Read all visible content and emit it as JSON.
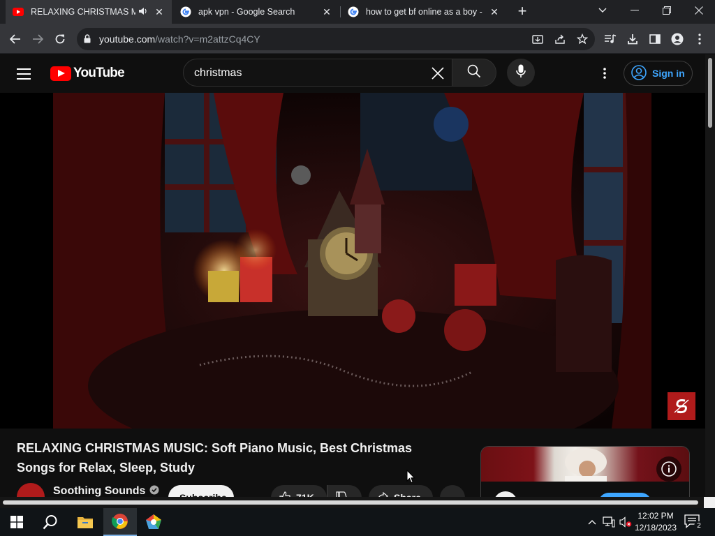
{
  "browser": {
    "tabs": [
      {
        "title": "RELAXING CHRISTMAS MUS",
        "favicon": "youtube-icon",
        "audio": true,
        "active": true
      },
      {
        "title": "apk vpn - Google Search",
        "favicon": "google-icon",
        "active": false
      },
      {
        "title": "how to get bf online as a boy - G",
        "favicon": "google-icon",
        "active": false
      }
    ],
    "url_domain": "youtube.com",
    "url_path": "/watch?v=m2attzCq4CY"
  },
  "youtube": {
    "logo_text": "YouTube",
    "search_query": "christmas",
    "signin_label": "Sign in"
  },
  "video": {
    "title": "RELAXING CHRISTMAS MUSIC: Soft Piano Music, Best Christmas Songs for Relax, Sleep, Study",
    "channel": "Soothing Sounds",
    "verified": true,
    "subscribe_label": "Subscribe",
    "likes": "71K",
    "share_label": "Share"
  },
  "taskbar": {
    "time": "12:02 PM",
    "date": "12/18/2023",
    "notification_count": "2"
  },
  "colors": {
    "youtube_red": "#ff0000",
    "link_blue": "#3ea6ff",
    "background": "#0f0f0f",
    "chrome_dark": "#202124",
    "chrome_toolbar": "#35363a"
  }
}
